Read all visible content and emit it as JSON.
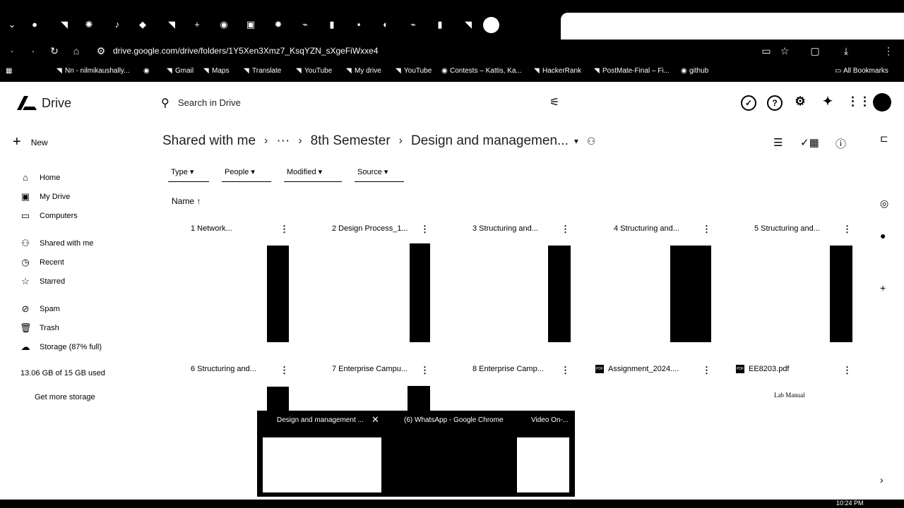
{
  "browser": {
    "url": "drive.google.com/drive/folders/1Y5Xen3Xmz7_KsqYZN_sXgeFiWxxe4",
    "bookmarks": [
      "Nn - nilmikaushally...",
      "Gmail",
      "Maps",
      "Translate",
      "YouTube",
      "My drive",
      "YouTube",
      "Contests – Kattis, Ka...",
      "HackerRank",
      "PostMate-Final – Fi...",
      "github"
    ],
    "all_bookmarks": "All Bookmarks"
  },
  "drive": {
    "logo_text": "Drive",
    "search_placeholder": "Search in Drive",
    "new_label": "New",
    "nav": [
      {
        "label": "Home",
        "icon": "home-icon"
      },
      {
        "label": "My Drive",
        "icon": "my-drive-icon"
      },
      {
        "label": "Computers",
        "icon": "computers-icon"
      },
      {
        "label": "Shared with me",
        "icon": "shared-icon"
      },
      {
        "label": "Recent",
        "icon": "recent-icon"
      },
      {
        "label": "Starred",
        "icon": "star-icon"
      },
      {
        "label": "Spam",
        "icon": "spam-icon"
      },
      {
        "label": "Trash",
        "icon": "trash-icon"
      },
      {
        "label": "Storage (87% full)",
        "icon": "cloud-icon"
      }
    ],
    "storage_used": "13.06 GB of 15 GB used",
    "get_more_storage": "Get more storage",
    "breadcrumb": [
      "Shared with me",
      "···",
      "8th Semester",
      "Design and managemen..."
    ],
    "filters": [
      "Type",
      "People",
      "Modified",
      "Source"
    ],
    "sort_label": "Name",
    "files": [
      {
        "name": "1 Network..."
      },
      {
        "name": "2 Design Process_1..."
      },
      {
        "name": "3 Structuring and..."
      },
      {
        "name": "4 Structuring and..."
      },
      {
        "name": "5 Structuring and..."
      },
      {
        "name": "6 Structuring and..."
      },
      {
        "name": "7 Enterprise Campu..."
      },
      {
        "name": "8 Enterprise Camp..."
      },
      {
        "name": "Assignment_2024...."
      },
      {
        "name": "EE8203.pdf"
      }
    ],
    "pdf_badge": "PDF",
    "preview_lab_manual": "Lab Manual"
  },
  "taskbar_preview": {
    "windows": [
      "Design and management ...",
      "(6) WhatsApp - Google Chrome",
      "Video On-..."
    ]
  },
  "taskbar": {
    "time": "10:24 PM"
  }
}
